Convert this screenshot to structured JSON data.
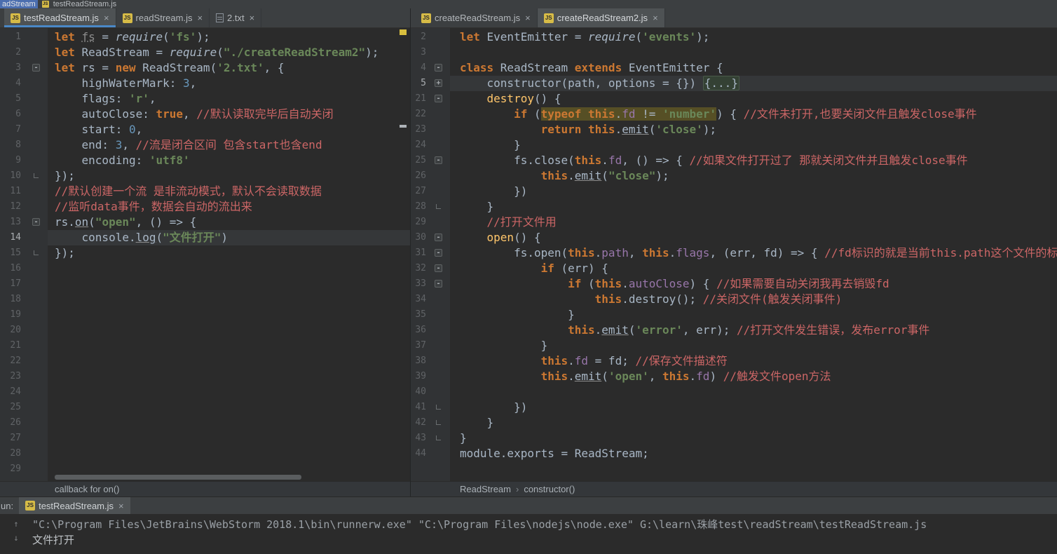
{
  "window": {
    "title_highlight": "adStream",
    "title_file": "testReadStream.js"
  },
  "colors": {
    "accent_blue": "#4A88C7",
    "editor_bg": "#2b2b2b",
    "gutter_bg": "#313335",
    "tab_bg": "#3c3f41",
    "title_selection": "#4b6eaf",
    "changed_marker_yellow": "#d9bf3e",
    "keyword": "#cc7832",
    "string": "#6a8759",
    "number": "#6897bb",
    "comment": "#cc6666",
    "field": "#9876aa",
    "function": "#ffc66b",
    "usage_highlight": "#564f25"
  },
  "icons": {
    "js_badge": "JS",
    "close": "×",
    "scroll_up": "↑",
    "scroll_down": "↓",
    "breadcrumb_sep": "›"
  },
  "left_pane": {
    "tabs": [
      {
        "label": "testReadStream.js",
        "icon": "js",
        "selected": true
      },
      {
        "label": "readStream.js",
        "icon": "js",
        "selected": false
      },
      {
        "label": "2.txt",
        "icon": "txt",
        "selected": false
      }
    ],
    "status_hint": "callback for on()",
    "lines": [
      {
        "n": 1,
        "s": [
          [
            "let ",
            "kw"
          ],
          [
            "fs",
            "dim"
          ],
          [
            " = ",
            ""
          ],
          [
            "require",
            "it"
          ],
          [
            "(",
            ""
          ],
          [
            "'fs'",
            "str"
          ],
          [
            ");",
            ""
          ]
        ]
      },
      {
        "n": 2,
        "s": [
          [
            "let ",
            "kw"
          ],
          [
            "ReadStream = ",
            ""
          ],
          [
            "require",
            "it"
          ],
          [
            "(",
            ""
          ],
          [
            "\"./createReadStream2\"",
            "str"
          ],
          [
            ");",
            ""
          ]
        ]
      },
      {
        "n": 3,
        "f": "-",
        "s": [
          [
            "let ",
            "kw"
          ],
          [
            "rs = ",
            ""
          ],
          [
            "new ",
            "kw"
          ],
          [
            "ReadStream(",
            ""
          ],
          [
            "'2.txt'",
            "str"
          ],
          [
            ", {",
            ""
          ]
        ]
      },
      {
        "n": 4,
        "s": [
          [
            "    highWaterMark: ",
            ""
          ],
          [
            "3",
            "num"
          ],
          [
            ",",
            ""
          ]
        ]
      },
      {
        "n": 5,
        "s": [
          [
            "    flags: ",
            ""
          ],
          [
            "'r'",
            "str"
          ],
          [
            ",",
            ""
          ]
        ]
      },
      {
        "n": 6,
        "s": [
          [
            "    autoClose: ",
            ""
          ],
          [
            "true",
            "kw"
          ],
          [
            ", ",
            ""
          ],
          [
            "//默认读取完毕后自动关闭",
            "cmt"
          ]
        ]
      },
      {
        "n": 7,
        "s": [
          [
            "    start: ",
            ""
          ],
          [
            "0",
            "num"
          ],
          [
            ",",
            ""
          ]
        ]
      },
      {
        "n": 8,
        "s": [
          [
            "    end: ",
            ""
          ],
          [
            "3",
            "num"
          ],
          [
            ", ",
            ""
          ],
          [
            "//流是闭合区间 包含start也含end",
            "cmt"
          ]
        ]
      },
      {
        "n": 9,
        "s": [
          [
            "    encoding: ",
            ""
          ],
          [
            "'utf8'",
            "str"
          ]
        ]
      },
      {
        "n": 10,
        "f": "L",
        "s": [
          [
            "});",
            ""
          ]
        ]
      },
      {
        "n": 11,
        "s": [
          [
            "//默认创建一个流 是非流动模式，默认不会读取数据",
            "cmt"
          ]
        ]
      },
      {
        "n": 12,
        "s": [
          [
            "//监听data事件，数据会自动的流出来",
            "cmt"
          ]
        ]
      },
      {
        "n": 13,
        "f": "-",
        "s": [
          [
            "rs.",
            ""
          ],
          [
            "on",
            "u"
          ],
          [
            "(",
            ""
          ],
          [
            "\"open\"",
            "str"
          ],
          [
            ", () => {",
            ""
          ]
        ]
      },
      {
        "n": 14,
        "h": true,
        "s": [
          [
            "    console.",
            ""
          ],
          [
            "log",
            "u"
          ],
          [
            "(",
            ""
          ],
          [
            "\"文件打开\"",
            "str"
          ],
          [
            ")",
            ""
          ]
        ]
      },
      {
        "n": 15,
        "f": "L",
        "s": [
          [
            "});",
            ""
          ]
        ]
      },
      {
        "n": 16,
        "s": []
      },
      {
        "n": 17,
        "s": []
      },
      {
        "n": 18,
        "s": []
      },
      {
        "n": 19,
        "s": []
      },
      {
        "n": 20,
        "s": []
      },
      {
        "n": 21,
        "s": []
      },
      {
        "n": 22,
        "s": []
      },
      {
        "n": 23,
        "s": []
      },
      {
        "n": 24,
        "s": []
      },
      {
        "n": 25,
        "s": []
      },
      {
        "n": 26,
        "s": []
      },
      {
        "n": 27,
        "s": []
      },
      {
        "n": 28,
        "s": []
      },
      {
        "n": 29,
        "s": []
      }
    ]
  },
  "right_pane": {
    "tabs": [
      {
        "label": "createReadStream.js",
        "icon": "js",
        "selected": false
      },
      {
        "label": "createReadStream2.js",
        "icon": "js",
        "selected": true
      }
    ],
    "breadcrumbs": [
      "ReadStream",
      "constructor()"
    ],
    "lines": [
      {
        "n": 2,
        "s": [
          [
            "let ",
            "kw"
          ],
          [
            "EventEmitter = ",
            ""
          ],
          [
            "require",
            "it"
          ],
          [
            "(",
            ""
          ],
          [
            "'events'",
            "str"
          ],
          [
            ");",
            ""
          ]
        ]
      },
      {
        "n": 3,
        "s": []
      },
      {
        "n": 4,
        "f": "-",
        "s": [
          [
            "class ",
            "kw"
          ],
          [
            "ReadStream ",
            ""
          ],
          [
            "extends ",
            "kw"
          ],
          [
            "EventEmitter",
            ""
          ],
          [
            " {",
            ""
          ]
        ]
      },
      {
        "n": 5,
        "f": "+",
        "h": true,
        "s": [
          [
            "    constructor(path, options = {}) ",
            ""
          ],
          [
            "{...}",
            "fold"
          ]
        ]
      },
      {
        "n": 21,
        "f": "-",
        "s": [
          [
            "    ",
            ""
          ],
          [
            "destroy",
            "fn"
          ],
          [
            "() {",
            ""
          ]
        ]
      },
      {
        "n": 22,
        "s": [
          [
            "        ",
            ""
          ],
          [
            "if",
            "kw"
          ],
          [
            " (",
            ""
          ],
          [
            "typeof ",
            "kw hl"
          ],
          [
            "this",
            "kw hl"
          ],
          [
            ".",
            "hl"
          ],
          [
            "fd",
            "mem hl"
          ],
          [
            " != ",
            "hl"
          ],
          [
            "'number'",
            "str hl"
          ],
          [
            ") { ",
            ""
          ],
          [
            "//文件未打开,也要关闭文件且触发close事件",
            "cmt"
          ]
        ]
      },
      {
        "n": 23,
        "s": [
          [
            "            ",
            ""
          ],
          [
            "return ",
            "kw"
          ],
          [
            "this",
            "kw"
          ],
          [
            ".",
            ""
          ],
          [
            "emit",
            "u"
          ],
          [
            "(",
            ""
          ],
          [
            "'close'",
            "str"
          ],
          [
            ");",
            ""
          ]
        ]
      },
      {
        "n": 24,
        "s": [
          [
            "        }",
            ""
          ]
        ]
      },
      {
        "n": 25,
        "f": "-",
        "s": [
          [
            "        fs.close(",
            ""
          ],
          [
            "this",
            "kw"
          ],
          [
            ".",
            ""
          ],
          [
            "fd",
            "mem"
          ],
          [
            ", () => { ",
            ""
          ],
          [
            "//如果文件打开过了 那就关闭文件并且触发close事件",
            "cmt"
          ]
        ]
      },
      {
        "n": 26,
        "s": [
          [
            "            ",
            ""
          ],
          [
            "this",
            "kw"
          ],
          [
            ".",
            ""
          ],
          [
            "emit",
            "u"
          ],
          [
            "(",
            ""
          ],
          [
            "\"close\"",
            "str"
          ],
          [
            ");",
            ""
          ]
        ]
      },
      {
        "n": 27,
        "s": [
          [
            "        })",
            ""
          ]
        ]
      },
      {
        "n": 28,
        "f": "L",
        "s": [
          [
            "    }",
            ""
          ]
        ]
      },
      {
        "n": 29,
        "s": [
          [
            "    ",
            ""
          ],
          [
            "//打开文件用",
            "cmt"
          ]
        ]
      },
      {
        "n": 30,
        "f": "-",
        "s": [
          [
            "    ",
            ""
          ],
          [
            "open",
            "fn"
          ],
          [
            "() {",
            ""
          ]
        ]
      },
      {
        "n": 31,
        "f": "-",
        "s": [
          [
            "        fs.open(",
            ""
          ],
          [
            "this",
            "kw"
          ],
          [
            ".",
            ""
          ],
          [
            "path",
            "mem"
          ],
          [
            ", ",
            ""
          ],
          [
            "this",
            "kw"
          ],
          [
            ".",
            ""
          ],
          [
            "flags",
            "mem"
          ],
          [
            ", (err, fd) => { ",
            ""
          ],
          [
            "//fd标识的就是当前this.path这个文件的标识",
            "cmt"
          ]
        ]
      },
      {
        "n": 32,
        "f": "-",
        "s": [
          [
            "            ",
            ""
          ],
          [
            "if",
            "kw"
          ],
          [
            " (err) {",
            ""
          ]
        ]
      },
      {
        "n": 33,
        "f": "-",
        "s": [
          [
            "                ",
            ""
          ],
          [
            "if",
            "kw"
          ],
          [
            " (",
            ""
          ],
          [
            "this",
            "kw"
          ],
          [
            ".",
            ""
          ],
          [
            "autoClose",
            "mem"
          ],
          [
            ") { ",
            ""
          ],
          [
            "//如果需要自动关闭我再去销毁fd",
            "cmt"
          ]
        ]
      },
      {
        "n": 34,
        "s": [
          [
            "                    ",
            ""
          ],
          [
            "this",
            "kw"
          ],
          [
            ".destroy(); ",
            ""
          ],
          [
            "//关闭文件(触发关闭事件)",
            "cmt"
          ]
        ]
      },
      {
        "n": 35,
        "s": [
          [
            "                }",
            ""
          ]
        ]
      },
      {
        "n": 36,
        "s": [
          [
            "                ",
            ""
          ],
          [
            "this",
            "kw"
          ],
          [
            ".",
            ""
          ],
          [
            "emit",
            "u"
          ],
          [
            "(",
            ""
          ],
          [
            "'error'",
            "str"
          ],
          [
            ", err); ",
            ""
          ],
          [
            "//打开文件发生错误，发布error事件",
            "cmt"
          ]
        ]
      },
      {
        "n": 37,
        "s": [
          [
            "            }",
            ""
          ]
        ]
      },
      {
        "n": 38,
        "s": [
          [
            "            ",
            ""
          ],
          [
            "this",
            "kw"
          ],
          [
            ".",
            ""
          ],
          [
            "fd",
            "mem"
          ],
          [
            " = fd; ",
            ""
          ],
          [
            "//保存文件描述符",
            "cmt"
          ]
        ]
      },
      {
        "n": 39,
        "s": [
          [
            "            ",
            ""
          ],
          [
            "this",
            "kw"
          ],
          [
            ".",
            ""
          ],
          [
            "emit",
            "u"
          ],
          [
            "(",
            ""
          ],
          [
            "'open'",
            "str"
          ],
          [
            ", ",
            ""
          ],
          [
            "this",
            "kw"
          ],
          [
            ".",
            ""
          ],
          [
            "fd",
            "mem"
          ],
          [
            ") ",
            ""
          ],
          [
            "//触发文件open方法",
            "cmt"
          ]
        ]
      },
      {
        "n": 40,
        "s": []
      },
      {
        "n": 41,
        "f": "L",
        "s": [
          [
            "        })",
            ""
          ]
        ]
      },
      {
        "n": 42,
        "f": "L",
        "s": [
          [
            "    }",
            ""
          ]
        ]
      },
      {
        "n": 43,
        "f": "L",
        "s": [
          [
            "}",
            ""
          ]
        ]
      },
      {
        "n": 44,
        "s": [
          [
            "module.exports = ReadStream;",
            ""
          ]
        ]
      }
    ]
  },
  "run_panel": {
    "label_fragment": "un:",
    "tab": "testReadStream.js",
    "console": [
      "\"C:\\Program Files\\JetBrains\\WebStorm 2018.1\\bin\\runnerw.exe\" \"C:\\Program Files\\nodejs\\node.exe\" G:\\learn\\珠峰test\\readStream\\testReadStream.js",
      "文件打开"
    ]
  }
}
